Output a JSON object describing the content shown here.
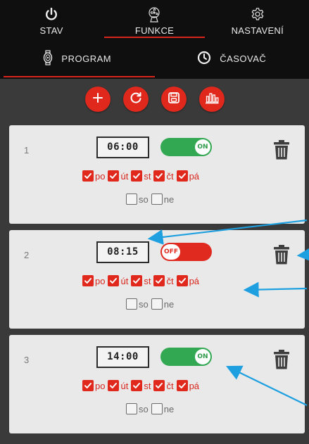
{
  "topnav": {
    "tabs": [
      {
        "label": "STAV",
        "icon": "power-icon"
      },
      {
        "label": "FUNKCE",
        "icon": "fan-icon",
        "active": true
      },
      {
        "label": "NASTAVENÍ",
        "icon": "gear-icon"
      }
    ]
  },
  "subnav": {
    "tabs": [
      {
        "label": "PROGRAM",
        "icon": "program-icon",
        "active": true
      },
      {
        "label": "ČASOVAČ",
        "icon": "clock-icon"
      }
    ]
  },
  "toolbar": {
    "buttons": [
      "add-icon",
      "refresh-icon",
      "save-icon",
      "chart-icon"
    ]
  },
  "programs": [
    {
      "number": "1",
      "time": "06:00",
      "toggle": "ON",
      "enabled": true,
      "days": [
        {
          "label": "po",
          "checked": true
        },
        {
          "label": "út",
          "checked": true
        },
        {
          "label": "st",
          "checked": true
        },
        {
          "label": "čt",
          "checked": true
        },
        {
          "label": "pá",
          "checked": true
        },
        {
          "label": "so",
          "checked": false
        },
        {
          "label": "ne",
          "checked": false
        }
      ]
    },
    {
      "number": "2",
      "time": "08:15",
      "toggle": "OFF",
      "enabled": false,
      "days": [
        {
          "label": "po",
          "checked": true
        },
        {
          "label": "út",
          "checked": true
        },
        {
          "label": "st",
          "checked": true
        },
        {
          "label": "čt",
          "checked": true
        },
        {
          "label": "pá",
          "checked": true
        },
        {
          "label": "so",
          "checked": false
        },
        {
          "label": "ne",
          "checked": false
        }
      ]
    },
    {
      "number": "3",
      "time": "14:00",
      "toggle": "ON",
      "enabled": true,
      "days": [
        {
          "label": "po",
          "checked": true
        },
        {
          "label": "út",
          "checked": true
        },
        {
          "label": "st",
          "checked": true
        },
        {
          "label": "čt",
          "checked": true
        },
        {
          "label": "pá",
          "checked": true
        },
        {
          "label": "so",
          "checked": false
        },
        {
          "label": "ne",
          "checked": false
        }
      ]
    }
  ],
  "colors": {
    "accent": "#e0281c",
    "toggle_on": "#33a853",
    "annotation_arrow": "#1ea0e0"
  }
}
